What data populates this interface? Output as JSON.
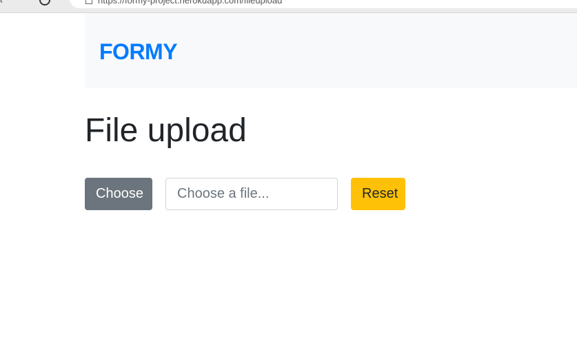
{
  "browser": {
    "url": "https://formy-project.herokuapp.com/fileupload"
  },
  "navbar": {
    "brand": "FORMY"
  },
  "main": {
    "title": "File upload",
    "choose_button": "Choose",
    "file_input_placeholder": "Choose a file...",
    "reset_button": "Reset"
  },
  "colors": {
    "brand": "#007bff",
    "navbar_bg": "#f8f9fa",
    "choose_button": "#6c757d",
    "reset_button": "#ffc107",
    "title_text": "#212529"
  }
}
